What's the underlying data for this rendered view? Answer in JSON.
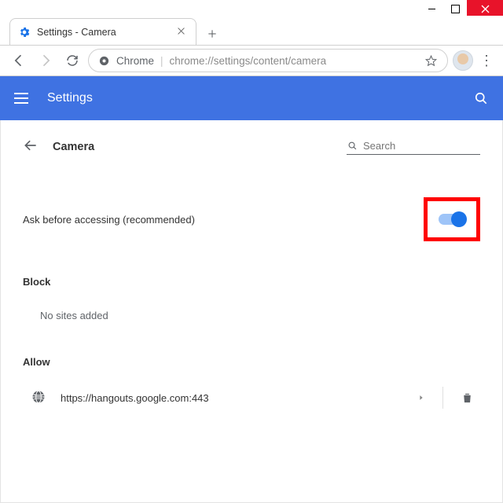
{
  "window": {
    "tab_title": "Settings - Camera"
  },
  "addressbar": {
    "scheme_label": "Chrome",
    "url": "chrome://settings/content/camera"
  },
  "bluebar": {
    "title": "Settings"
  },
  "page": {
    "title": "Camera",
    "search_placeholder": "Search",
    "ask_label": "Ask before accessing (recommended)",
    "ask_toggle_on": true,
    "block_label": "Block",
    "block_empty": "No sites added",
    "allow_label": "Allow",
    "allow_sites": [
      {
        "url": "https://hangouts.google.com:443"
      }
    ]
  }
}
